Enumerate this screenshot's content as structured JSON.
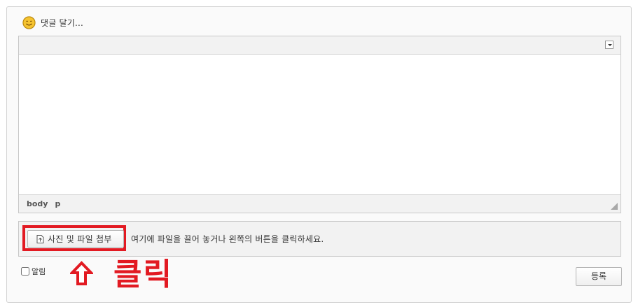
{
  "comment": {
    "header_title": "댓글 달기...",
    "smiley_icon": "smiley-face-icon"
  },
  "editor": {
    "toolbar_toggle_icon": "dropdown-toggle-icon",
    "path": [
      "body",
      "p"
    ],
    "resize_icon": "resize-grip-icon"
  },
  "attachment": {
    "button_label": "사진 및 파일 첨부",
    "button_icon": "upload-icon",
    "hint_text": "여기에 파일을 끌어 놓거나 왼쪽의 버튼을 클릭하세요."
  },
  "notify": {
    "label": "알림",
    "checked": false
  },
  "submit": {
    "label": "등록"
  },
  "annotation": {
    "click_text": "클릭",
    "arrow_icon": "up-arrow-icon",
    "color": "#e21a22"
  },
  "colors": {
    "panel_background": "#fafafa",
    "toolbar_background": "#f2f2f2",
    "border": "#c8c8c8",
    "smiley": "#f5c330"
  }
}
